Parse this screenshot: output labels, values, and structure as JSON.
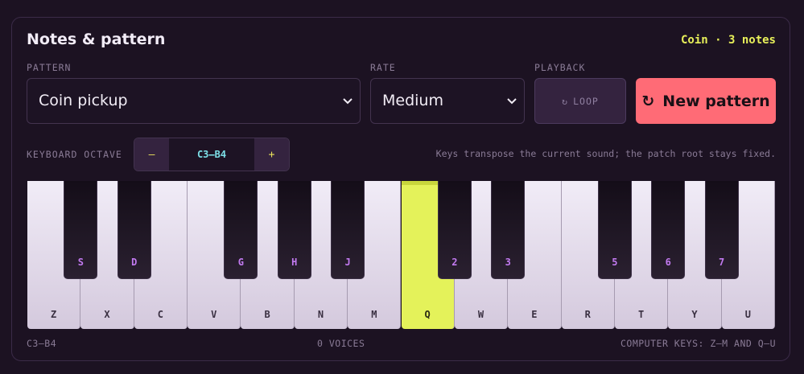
{
  "panel": {
    "title": "Notes & pattern",
    "summary": "Coin · 3 notes"
  },
  "controls": {
    "pattern_label": "PATTERN",
    "pattern_value": "Coin pickup",
    "rate_label": "RATE",
    "rate_value": "Medium",
    "playback_label": "PLAYBACK",
    "loop_icon": "↻",
    "loop_label": "LOOP",
    "new_icon": "↻",
    "new_label": "New pattern"
  },
  "octave": {
    "label": "KEYBOARD OCTAVE",
    "minus": "–",
    "value": "C3–B4",
    "plus": "+"
  },
  "hint": "Keys transpose the current sound; the patch root stays fixed.",
  "keyboard": {
    "white_keys": [
      "Z",
      "X",
      "C",
      "V",
      "B",
      "N",
      "M",
      "Q",
      "W",
      "E",
      "R",
      "T",
      "Y",
      "U"
    ],
    "black_keys": [
      "S",
      "D",
      "G",
      "H",
      "J",
      "2",
      "3",
      "5",
      "6",
      "7"
    ],
    "active_white_key": "Q"
  },
  "footer": {
    "range": "C3–B4",
    "voices": "0 VOICES",
    "computer_keys": "COMPUTER KEYS: Z–M AND Q–U"
  },
  "colors": {
    "accent_new": "#ff6b76",
    "active_key": "#e4f25a",
    "summary": "#e8f05a",
    "octave_value": "#7de0e8",
    "black_key_label": "#c27af0"
  }
}
